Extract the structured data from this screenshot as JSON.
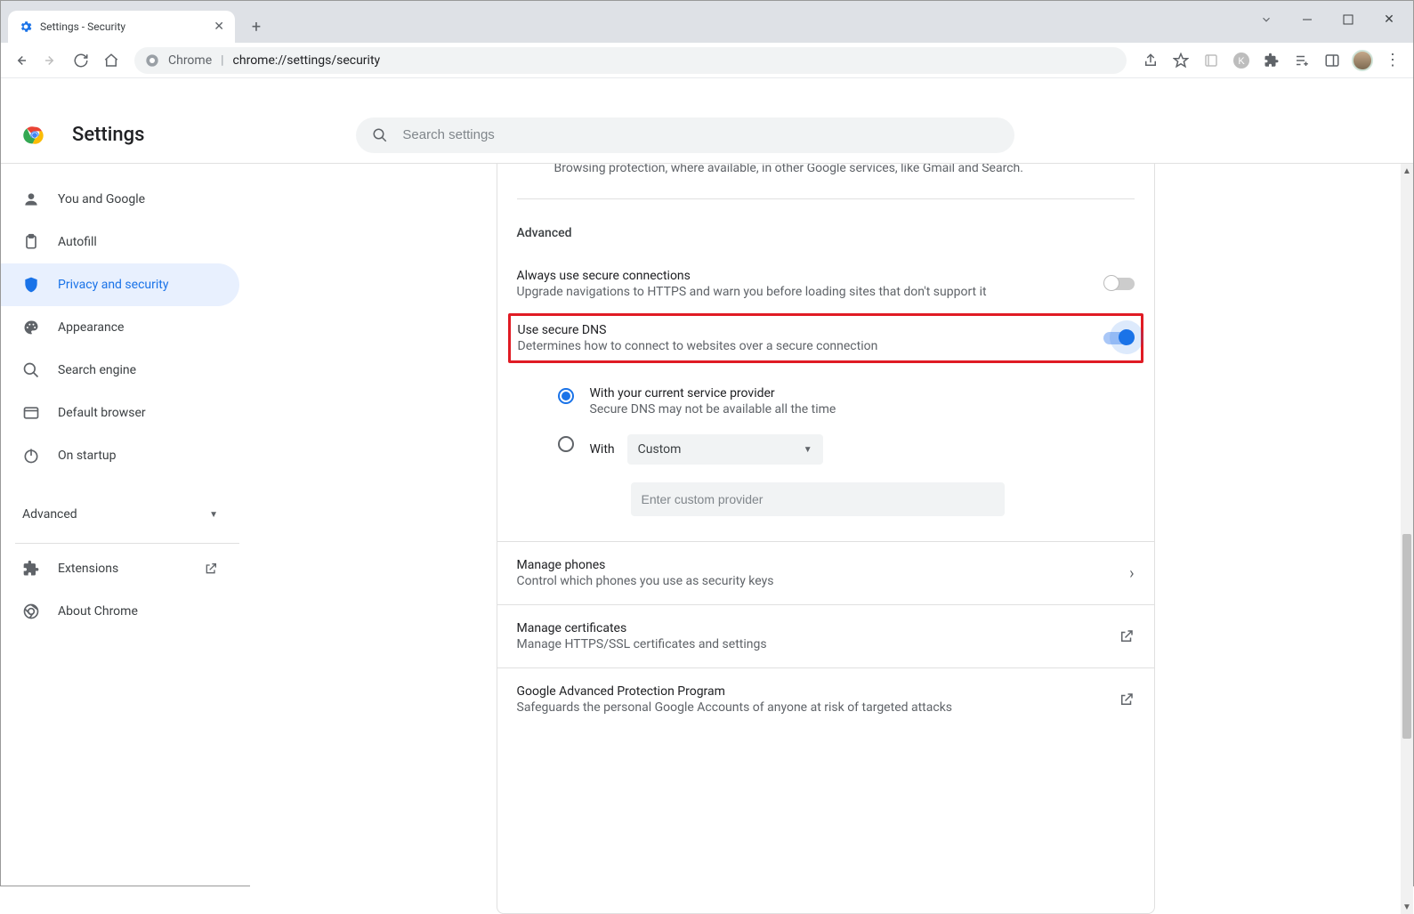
{
  "window": {
    "tab_title": "Settings - Security"
  },
  "omnibox": {
    "label": "Chrome",
    "url": "chrome://settings/security"
  },
  "header": {
    "title": "Settings",
    "search_placeholder": "Search settings"
  },
  "sidebar": {
    "items": [
      {
        "label": "You and Google"
      },
      {
        "label": "Autofill"
      },
      {
        "label": "Privacy and security"
      },
      {
        "label": "Appearance"
      },
      {
        "label": "Search engine"
      },
      {
        "label": "Default browser"
      },
      {
        "label": "On startup"
      }
    ],
    "advanced": "Advanced",
    "extensions": "Extensions",
    "about": "About Chrome"
  },
  "main": {
    "truncated_line": "Browsing protection, where available, in other Google services, like Gmail and Search.",
    "advanced_heading": "Advanced",
    "secure_conn": {
      "title": "Always use secure connections",
      "sub": "Upgrade navigations to HTTPS and warn you before loading sites that don't support it",
      "on": false
    },
    "secure_dns": {
      "title": "Use secure DNS",
      "sub": "Determines how to connect to websites over a secure connection",
      "on": true,
      "opt_provider_title": "With your current service provider",
      "opt_provider_sub": "Secure DNS may not be available all the time",
      "opt_with_label": "With",
      "custom_selected": "Custom",
      "custom_placeholder": "Enter custom provider"
    },
    "links": [
      {
        "title": "Manage phones",
        "sub": "Control which phones you use as security keys",
        "icon": "chevron"
      },
      {
        "title": "Manage certificates",
        "sub": "Manage HTTPS/SSL certificates and settings",
        "icon": "external"
      },
      {
        "title": "Google Advanced Protection Program",
        "sub": "Safeguards the personal Google Accounts of anyone at risk of targeted attacks",
        "icon": "external"
      }
    ]
  }
}
